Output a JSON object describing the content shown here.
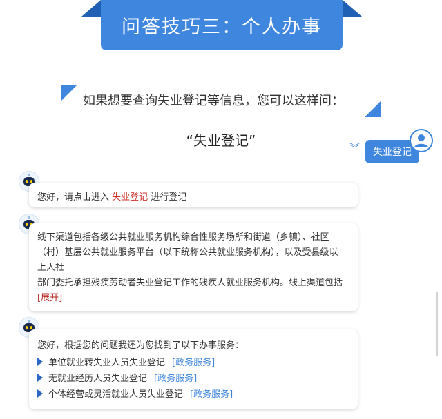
{
  "banner": {
    "title": "问答技巧三：个人办事"
  },
  "intro": {
    "text": "如果想要查询失业登记等信息，您可以这样问：",
    "query": "“失业登记”"
  },
  "user_message": {
    "text": "失业登记"
  },
  "messages": {
    "m1": {
      "prefix": "您好，请点击进入",
      "link": "失业登记",
      "suffix": "进行登记"
    },
    "m2": {
      "line1": "线下渠道包括各级公共就业服务机构综合性服务场所和街道（乡镇）、社区",
      "line2": "（村）基层公共就业服务平台（以下统称公共就业服务机构），以及受县级以",
      "line3": "上人社",
      "line4": "部门委托承担残疾劳动者失业登记工作的残疾人就业服务机构。线上渠道包括",
      "expand": "[展开]"
    },
    "m3": {
      "intro": "您好，根据您的问题我还为您找到了以下办事服务：",
      "services": [
        {
          "name": "单位就业转失业人员失业登记",
          "tag": "[政务服务]"
        },
        {
          "name": "无就业经历人员失业登记",
          "tag": "[政务服务]"
        },
        {
          "name": "个体经营或灵活就业人员失业登记",
          "tag": "[政务服务]"
        }
      ]
    }
  },
  "colors": {
    "primary": "#3f86de",
    "ribbon": "#1f5fb4",
    "link_red": "#d0322a",
    "triangle": "#2c66c9"
  },
  "icons": {
    "bot": "robot-avatar-icon",
    "user": "user-avatar-icon",
    "chevron": "double-chevron-down-icon",
    "bullet": "triangle-bullet-icon"
  }
}
